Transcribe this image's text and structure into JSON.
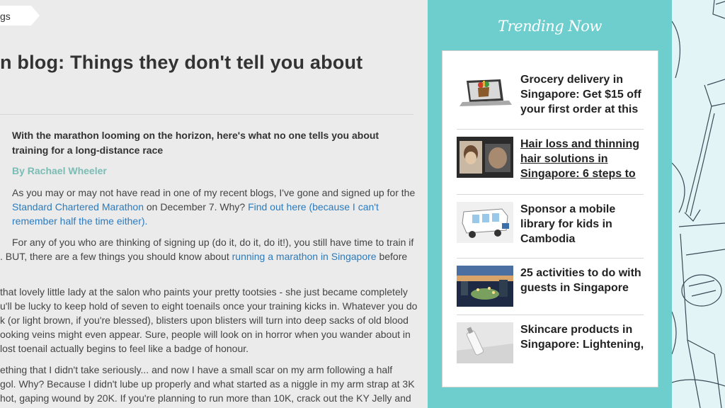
{
  "main": {
    "tag": "gs",
    "title": "n blog: Things they don't tell you about",
    "lead": [
      "With the marathon looming on the horizon, here's what no one tells you about",
      "training for a long-distance race"
    ],
    "byline": "By Rachael Wheeler",
    "p1": {
      "l1": "As you may or may not have read in one of my recent blogs, I've gone and signed up for the",
      "l2_link": "Standard Chartered Marathon",
      "l2_text": " on December 7. Why? ",
      "l2_link2": "Find out here (because I can't",
      "l3_link": "remember half the time either)."
    },
    "p2": {
      "l1": "For any of you who are thinking of signing up (do it, do it, do it!), you still have time to train if",
      "l2_a": ". BUT, there are a few things you should know about ",
      "l2_link": "running a marathon in Singapore",
      "l2_b": " before"
    },
    "p3": [
      " that lovely little lady at the salon who paints your pretty tootsies - she just became completely",
      "u'll be lucky to keep hold of seven to eight toenails once your training kicks in. Whatever you do",
      "k (or light brown, if you're blessed), blisters upon blisters will turn into deep sacks of old blood",
      "ooking veins might even appear. Sure, people will look on in horror when you wander about in",
      " lost toenail actually begins to feel like a badge of honour."
    ],
    "p4": [
      "ething that I didn't take seriously... and now I have a small scar on my arm following a half",
      "gol. Why? Because I didn't lube up properly and what started as a niggle in my arm strap at 3K",
      " hot, gaping wound by 20K. If you're planning to run more than 10K, crack out the KY Jelly and"
    ]
  },
  "sidebar": {
    "heading": "Trending Now",
    "items": [
      {
        "title": "Grocery delivery in Singapore: Get $15 off your first order at this",
        "thumb": "laptop-groceries-icon"
      },
      {
        "title": "Hair loss and thinning hair solutions in Singapore: 6 steps to",
        "thumb": "hair-photo-icon"
      },
      {
        "title": "Sponsor a mobile library for kids in Cambodia",
        "thumb": "mobile-library-icon"
      },
      {
        "title": "25 activities to do with guests in Singapore",
        "thumb": "city-night-icon"
      },
      {
        "title": "Skincare products in Singapore: Lightening,",
        "thumb": "skincare-bottle-icon"
      }
    ]
  },
  "colors": {
    "background": "#ebebeb",
    "sidebar": "#6ecece",
    "link": "#2a7bbf",
    "byline": "#7bbcb5"
  }
}
